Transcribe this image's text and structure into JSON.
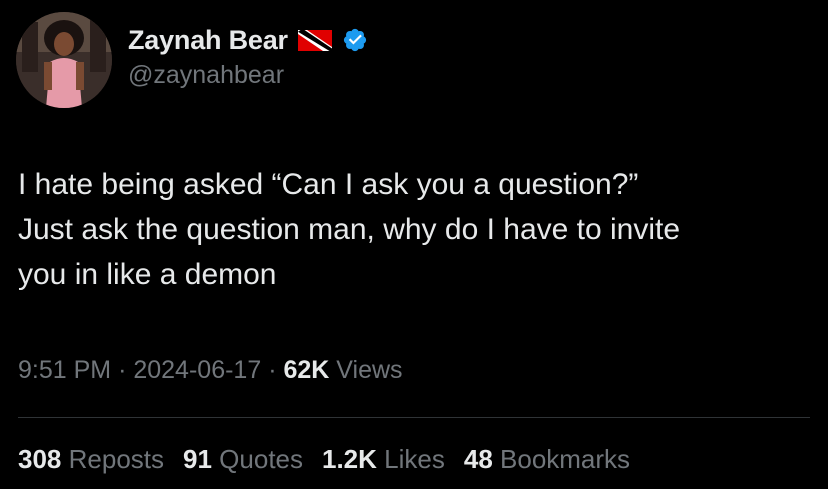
{
  "user": {
    "display_name": "Zaynah Bear",
    "handle": "@zaynahbear",
    "flag_icon": "trinidad-and-tobago-flag",
    "verified_icon": "verified-badge-icon"
  },
  "tweet": {
    "text": "I hate being asked “Can I ask you a question?”\nJust ask the question man, why do I have to invite\nyou in like a demon"
  },
  "meta": {
    "time": "9:51 PM",
    "sep1": "·",
    "date": "2024-06-17",
    "sep2": "·",
    "views_count": "62K",
    "views_label": "Views"
  },
  "stats": {
    "reposts": {
      "count": "308",
      "label": "Reposts"
    },
    "quotes": {
      "count": "91",
      "label": "Quotes"
    },
    "likes": {
      "count": "1.2K",
      "label": "Likes"
    },
    "bookmarks": {
      "count": "48",
      "label": "Bookmarks"
    }
  },
  "colors": {
    "background": "#000000",
    "text_primary": "#e7e9ea",
    "text_secondary": "#71767b",
    "verified_blue": "#1d9bf0",
    "divider": "#2f3336"
  }
}
